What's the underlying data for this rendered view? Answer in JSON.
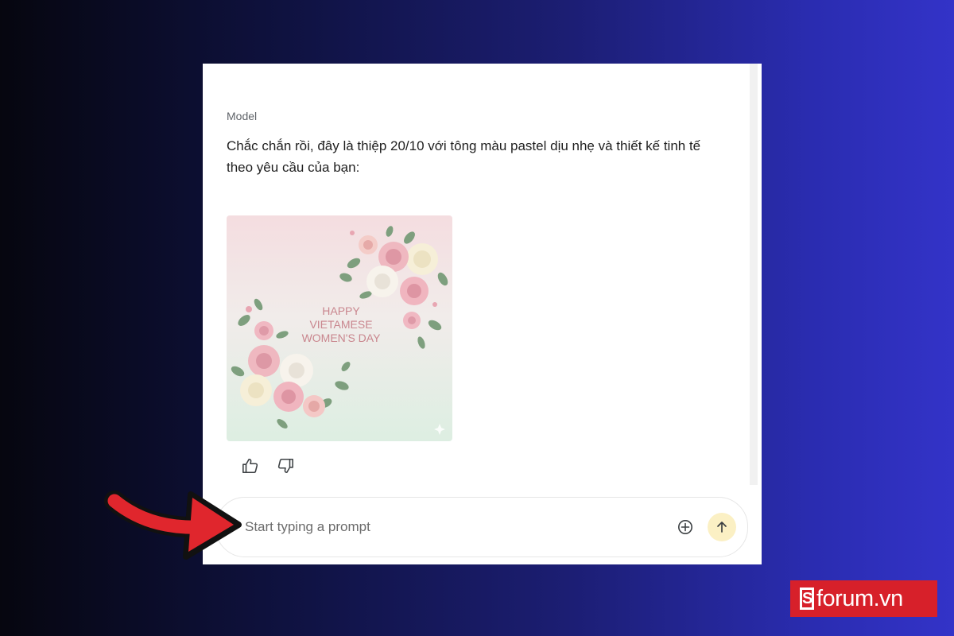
{
  "chat": {
    "role_label": "Model",
    "message": "Chắc chắn rồi, đây là thiệp 20/10 với tông màu pastel dịu nhẹ và thiết kế tinh tế theo yêu cầu của bạn:",
    "image": {
      "text_lines": [
        "HAPPY",
        "VIETAMESE",
        "WOMEN'S DAY"
      ],
      "text_color": "#c9868e"
    },
    "feedback": {
      "like_icon": "thumbs-up-icon",
      "dislike_icon": "thumbs-down-icon"
    }
  },
  "prompt": {
    "placeholder": "Start typing a prompt",
    "add_icon": "add-circle-icon",
    "send_icon": "arrow-up-icon"
  },
  "watermark": {
    "mark": "S",
    "text": "forum.vn"
  },
  "colors": {
    "send_button_bg": "#fbf0c4",
    "annotation_arrow": "#e0262d",
    "logo_bg": "#d7202a"
  }
}
